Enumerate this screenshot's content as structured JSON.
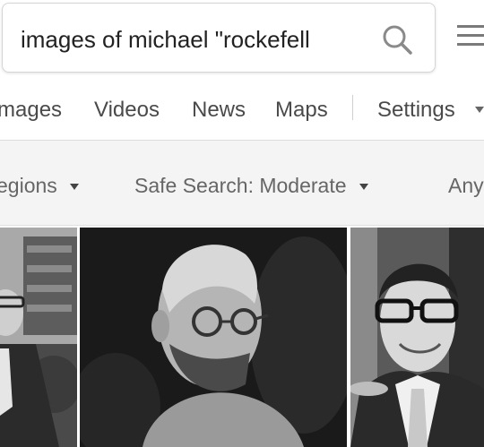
{
  "search": {
    "query": "images of michael \"rockefell"
  },
  "tabs": {
    "images": "mages",
    "videos": "Videos",
    "news": "News",
    "maps": "Maps",
    "settings": "Settings"
  },
  "filters": {
    "regions": "egions",
    "safe_search": "Safe Search: Moderate",
    "any_time": "Any"
  },
  "icons": {
    "search": "search-icon",
    "menu": "hamburger-menu-icon",
    "dropdown": "caret-down-icon"
  },
  "results": {
    "count": 3
  }
}
